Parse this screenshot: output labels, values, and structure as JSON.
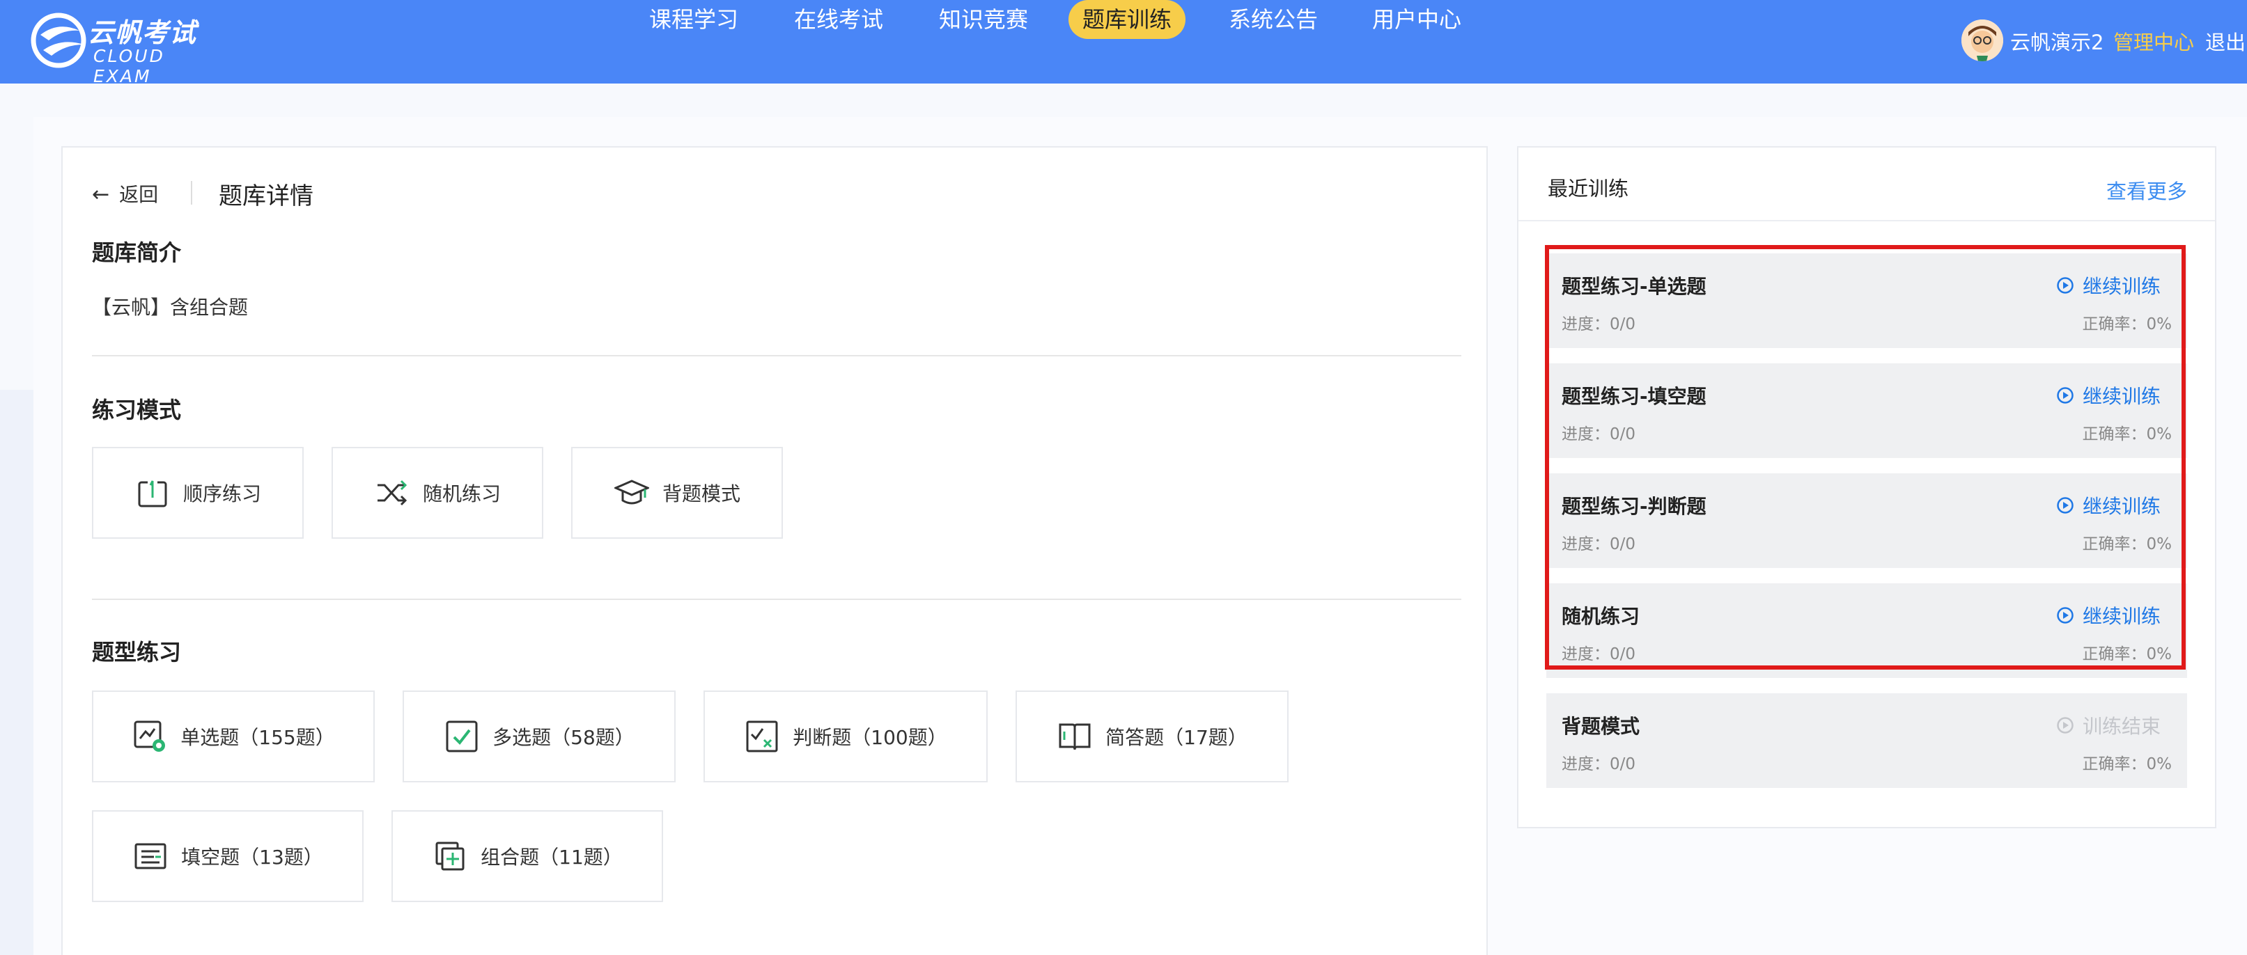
{
  "header": {
    "logo_cn": "云帆考试",
    "logo_en": "CLOUD EXAM",
    "nav": [
      {
        "label": "课程学习",
        "active": false
      },
      {
        "label": "在线考试",
        "active": false
      },
      {
        "label": "知识竞赛",
        "active": false
      },
      {
        "label": "题库训练",
        "active": true
      },
      {
        "label": "系统公告",
        "active": false
      },
      {
        "label": "用户中心",
        "active": false
      }
    ],
    "user_name": "云帆演示2",
    "admin_label": "管理中心",
    "logout_label": "退出",
    "brand_color": "#4a86f7",
    "active_color": "#f7cd4a"
  },
  "detail": {
    "back_label": "返回",
    "title": "题库详情",
    "intro_title": "题库简介",
    "intro_text": "【云帆】含组合题",
    "mode_title": "练习模式",
    "modes": [
      {
        "label": "顺序练习",
        "icon": "sequence-icon"
      },
      {
        "label": "随机练习",
        "icon": "shuffle-icon"
      },
      {
        "label": "背题模式",
        "icon": "graduation-cap-icon"
      }
    ],
    "type_title": "题型练习",
    "types": [
      {
        "label": "单选题（155题）",
        "icon": "single-choice-icon"
      },
      {
        "label": "多选题（58题）",
        "icon": "multi-choice-icon"
      },
      {
        "label": "判断题（100题）",
        "icon": "judge-icon"
      },
      {
        "label": "简答题（17题）",
        "icon": "book-icon"
      },
      {
        "label": "填空题（13题）",
        "icon": "fill-blank-icon"
      },
      {
        "label": "组合题（11题）",
        "icon": "combo-icon"
      }
    ]
  },
  "recent": {
    "title": "最近训练",
    "more_label": "查看更多",
    "items": [
      {
        "name": "题型练习-单选题",
        "progress": "进度：0/0",
        "rate": "正确率：0%",
        "action": "继续训练",
        "enabled": true
      },
      {
        "name": "题型练习-填空题",
        "progress": "进度：0/0",
        "rate": "正确率：0%",
        "action": "继续训练",
        "enabled": true
      },
      {
        "name": "题型练习-判断题",
        "progress": "进度：0/0",
        "rate": "正确率：0%",
        "action": "继续训练",
        "enabled": true
      },
      {
        "name": "随机练习",
        "progress": "进度：0/0",
        "rate": "正确率：0%",
        "action": "继续训练",
        "enabled": true
      },
      {
        "name": "背题模式",
        "progress": "进度：0/0",
        "rate": "正确率：0%",
        "action": "训练结束",
        "enabled": false
      }
    ],
    "action_color": "#1f78e6",
    "highlight_color": "#e01a1a"
  }
}
